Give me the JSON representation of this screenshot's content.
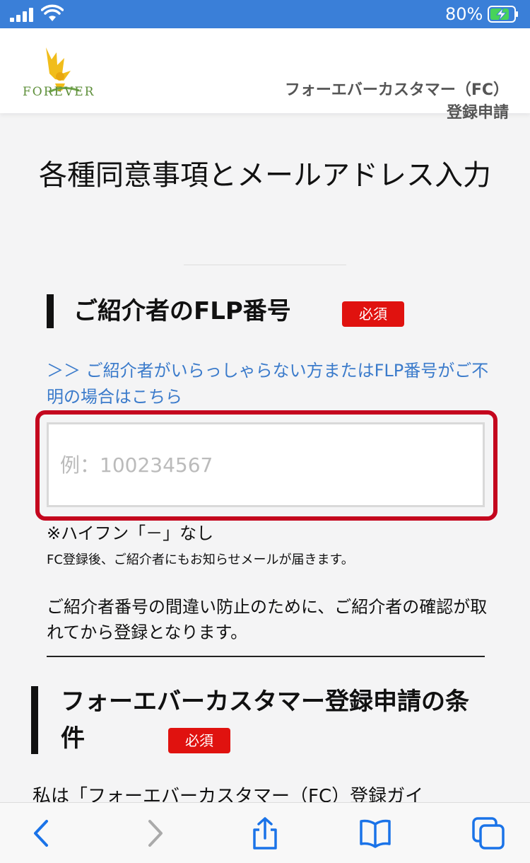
{
  "status_bar": {
    "battery_percent": "80%",
    "icons": [
      "signal-icon",
      "wifi-icon",
      "battery-charging-icon"
    ]
  },
  "header": {
    "logo_text": "FOREVER",
    "title": "フォーエバーカスタマー（FC）登録申請"
  },
  "page": {
    "title": "各種同意事項とメールアドレス入力"
  },
  "section_flp": {
    "heading": "ご紹介者のFLP番号",
    "required_label": "必須",
    "help_link": "＞＞ ご紹介者がいらっしゃらない方またはFLP番号がご不明の場合はこちら",
    "input_placeholder": "例：100234567",
    "input_value": "",
    "note_hyphen": "※ハイフン「－」なし",
    "note_notification": "FC登録後、ご紹介者にもお知らせメールが届きます。",
    "note_confirmation": "ご紹介者番号の間違い防止のために、ご紹介者の確認が取れてから登録となります。"
  },
  "section_conditions": {
    "heading": "フォーエバーカスタマー登録申請の条件",
    "required_label": "必須",
    "agreement_text": "私は「フォーエバーカスタマー（FC）登録ガイ"
  },
  "toolbar": {
    "icons": [
      "back-icon",
      "forward-icon",
      "share-icon",
      "bookmarks-icon",
      "tabs-icon"
    ],
    "accent": "#1a73e8"
  }
}
